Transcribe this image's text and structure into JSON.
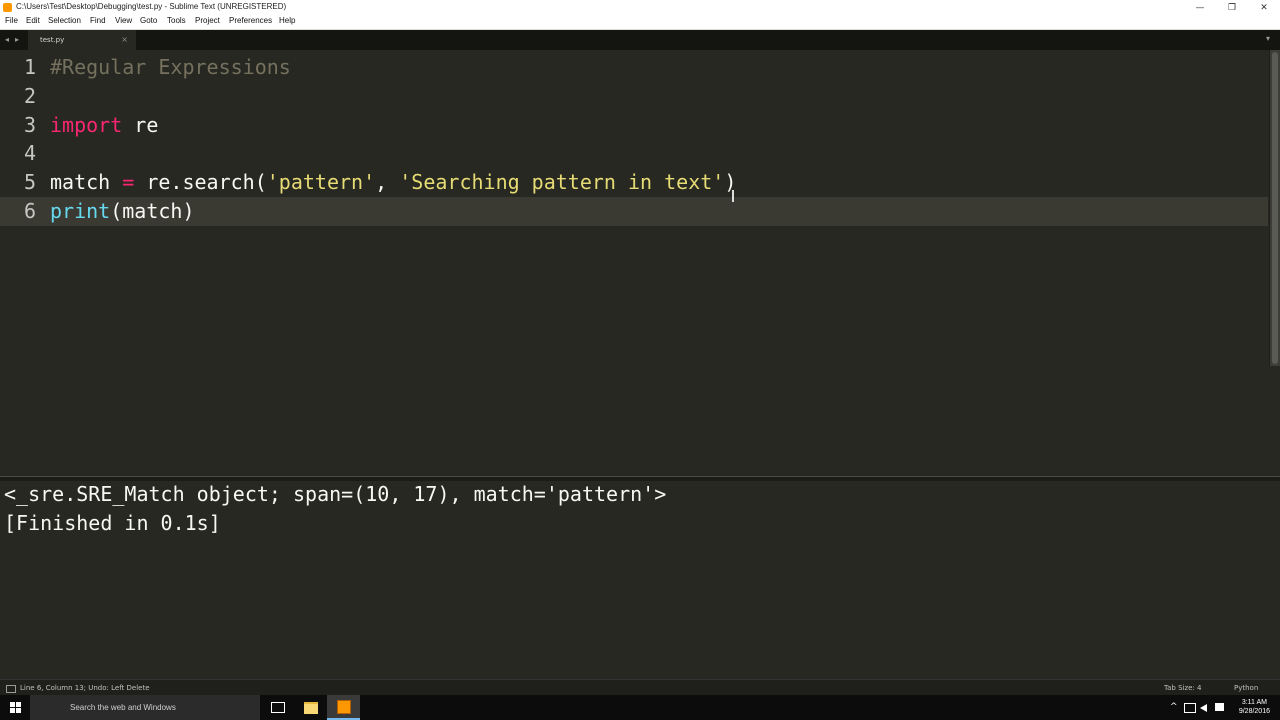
{
  "window": {
    "title": "C:\\Users\\Test\\Desktop\\Debugging\\test.py - Sublime Text (UNREGISTERED)",
    "controls": {
      "minimize": "—",
      "maximize": "❐",
      "close": "✕"
    }
  },
  "menu": [
    "File",
    "Edit",
    "Selection",
    "Find",
    "View",
    "Goto",
    "Tools",
    "Project",
    "Preferences",
    "Help"
  ],
  "tabs": {
    "nav_back": "◂",
    "nav_forward": "▸",
    "active_tab": "test.py",
    "close": "×",
    "dropdown": "▾"
  },
  "editor": {
    "line_numbers": [
      "1",
      "2",
      "3",
      "4",
      "5",
      "6"
    ],
    "active_line": 6,
    "lines": [
      {
        "comment": "#Regular Expressions"
      },
      {},
      {
        "keyword": "import",
        "rest": " re"
      },
      {},
      {
        "var": "match",
        "op": " = ",
        "call": "re.search(",
        "s1": "'pattern'",
        "comma": ", ",
        "s2": "'Searching pattern in text'",
        "close": ")"
      },
      {
        "builtin": "print",
        "rest": "(match)"
      }
    ]
  },
  "output": [
    "<_sre.SRE_Match object; span=(10, 17), match='pattern'>",
    "[Finished in 0.1s]"
  ],
  "status": {
    "position": "Line 6, Column 13; Undo: Left Delete",
    "tab_size": "Tab Size: 4",
    "syntax": "Python"
  },
  "taskbar": {
    "search_placeholder": "Search the web and Windows",
    "tray": {
      "chevron": "^"
    },
    "time": "3:11 AM",
    "date": "9/28/2016"
  }
}
